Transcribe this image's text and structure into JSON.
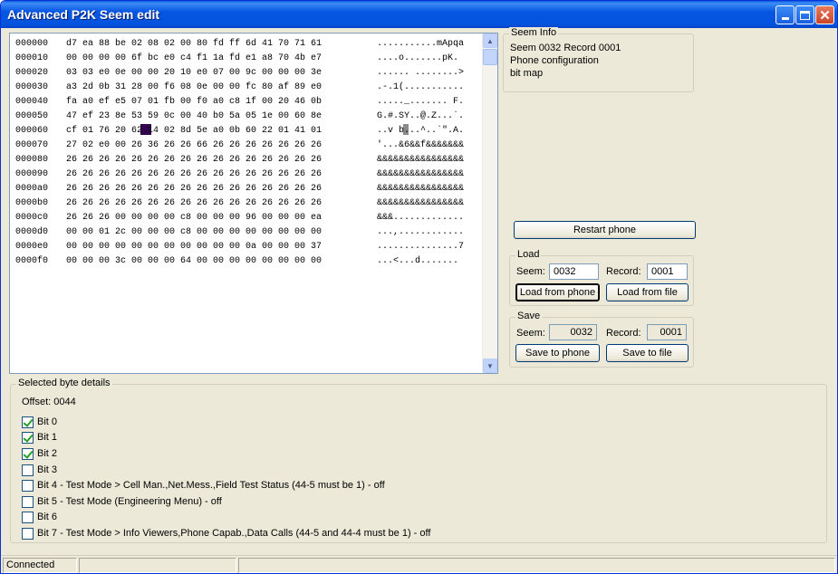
{
  "window": {
    "title": "Advanced P2K Seem edit"
  },
  "hex": {
    "rows": [
      {
        "offset": "000000",
        "bytes": "d7 ea 88 be 02 08 02 00 80 fd ff 6d 41 70 71 61",
        "ascii": "...........mApqa"
      },
      {
        "offset": "000010",
        "bytes": "00 00 00 00 6f bc e0 c4 f1 1a fd e1 a8 70 4b e7",
        "ascii": "....o.......pK."
      },
      {
        "offset": "000020",
        "bytes": "03 03 e0 0e 00 00 20 10 e0 07 00 9c 00 00 00 3e",
        "ascii": "...... ........>"
      },
      {
        "offset": "000030",
        "bytes": "a3 2d 0b 31 28 00 f6 08 0e 00 00 fc 80 af 89 e0",
        "ascii": ".-.1(..........."
      },
      {
        "offset": "000040",
        "bytes": "fa a0 ef e5 07 01 fb 00 f0 a0 c8 1f 00 20 46 0b",
        "ascii": "....._....... F."
      },
      {
        "offset": "000050",
        "bytes": "47 ef 23 8e 53 59 0c 00 40 b0 5a 05 1e 00 60 8e",
        "ascii": "G.#.SY..@.Z...`."
      },
      {
        "offset": "000060",
        "bytes": "cf 01 76 20 62 14 02 8d 5e a0 0b 60 22 01 41 01",
        "ascii": "..v b...^..`\".A."
      },
      {
        "offset": "000070",
        "bytes": "27 02 e0 00 26 36 26 26 66 26 26 26 26 26 26 26",
        "ascii": "'...&6&&f&&&&&&&"
      },
      {
        "offset": "000080",
        "bytes": "26 26 26 26 26 26 26 26 26 26 26 26 26 26 26 26",
        "ascii": "&&&&&&&&&&&&&&&&"
      },
      {
        "offset": "000090",
        "bytes": "26 26 26 26 26 26 26 26 26 26 26 26 26 26 26 26",
        "ascii": "&&&&&&&&&&&&&&&&"
      },
      {
        "offset": "0000a0",
        "bytes": "26 26 26 26 26 26 26 26 26 26 26 26 26 26 26 26",
        "ascii": "&&&&&&&&&&&&&&&&"
      },
      {
        "offset": "0000b0",
        "bytes": "26 26 26 26 26 26 26 26 26 26 26 26 26 26 26 26",
        "ascii": "&&&&&&&&&&&&&&&&"
      },
      {
        "offset": "0000c0",
        "bytes": "26 26 26 00 00 00 00 c8 00 00 00 96 00 00 00 ea",
        "ascii": "&&&............."
      },
      {
        "offset": "0000d0",
        "bytes": "00 00 01 2c 00 00 00 c8 00 00 00 00 00 00 00 00",
        "ascii": "...,............"
      },
      {
        "offset": "0000e0",
        "bytes": "00 00 00 00 00 00 00 00 00 00 00 0a 00 00 00 37",
        "ascii": "...............7"
      },
      {
        "offset": "0000f0",
        "bytes": "00 00 00 3c 00 00 00 64 00 00 00 00 00 00 00 00",
        "ascii": "...<...d......."
      }
    ]
  },
  "seem_info": {
    "title": "Seem Info",
    "line1": "Seem 0032 Record 0001",
    "line2": "Phone configuration",
    "line3": "bit map"
  },
  "restart_label": "Restart phone",
  "load": {
    "title": "Load",
    "seem_label": "Seem:",
    "seem_value": "0032",
    "record_label": "Record:",
    "record_value": "0001",
    "from_phone_label": "Load from phone",
    "from_file_label": "Load from file"
  },
  "save": {
    "title": "Save",
    "seem_label": "Seem:",
    "seem_value": "0032",
    "record_label": "Record:",
    "record_value": "0001",
    "to_phone_label": "Save to phone",
    "to_file_label": "Save to file"
  },
  "details": {
    "title": "Selected byte details",
    "offset": "Offset: 0044",
    "bits": [
      {
        "label": "Bit 0",
        "checked": true
      },
      {
        "label": "Bit 1",
        "checked": true
      },
      {
        "label": "Bit 2",
        "checked": true
      },
      {
        "label": "Bit 3",
        "checked": false
      },
      {
        "label": "Bit 4 - Test Mode > Cell Man.,Net.Mess.,Field Test Status (44-5 must be 1) - off",
        "checked": false
      },
      {
        "label": "Bit 5 - Test Mode (Engineering Menu) - off",
        "checked": false
      },
      {
        "label": "Bit 6",
        "checked": false
      },
      {
        "label": "Bit 7 - Test Mode > Info Viewers,Phone Capab.,Data Calls (44-5 and 44-4 must be 1) - off",
        "checked": false
      }
    ]
  },
  "status": {
    "text": "Connected",
    "cell2": "",
    "cell3": ""
  }
}
